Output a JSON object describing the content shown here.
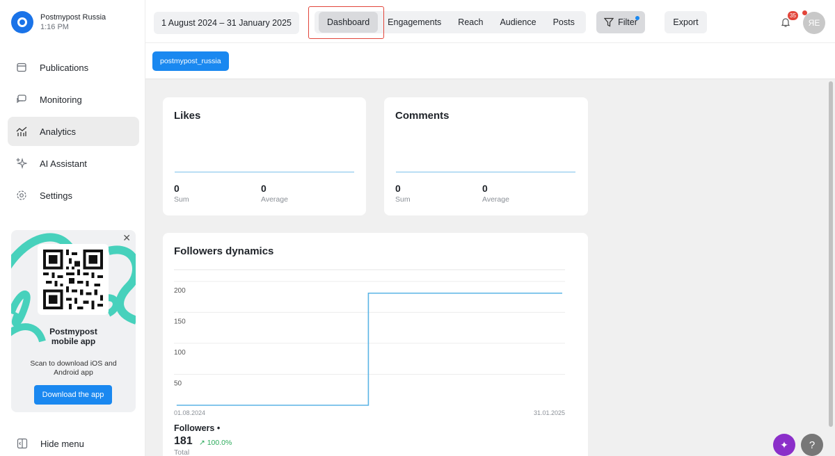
{
  "account": {
    "name": "Postmypost Russia",
    "time": "1:16 PM"
  },
  "nav": [
    {
      "label": "Publications",
      "icon": "calendar-icon"
    },
    {
      "label": "Monitoring",
      "icon": "chat-icon"
    },
    {
      "label": "Analytics",
      "icon": "analytics-icon",
      "active": true
    },
    {
      "label": "AI Assistant",
      "icon": "sparkle-icon"
    },
    {
      "label": "Settings",
      "icon": "gear-icon"
    }
  ],
  "promo": {
    "title": "Postmypost mobile app",
    "subtitle": "Scan to download iOS and Android app",
    "button": "Download the app",
    "close": "✕"
  },
  "hide_menu": "Hide menu",
  "topbar": {
    "date_range": "1 August 2024 – 31 January 2025",
    "tabs": [
      "Dashboard",
      "Engagements",
      "Reach",
      "Audience",
      "Posts"
    ],
    "active_tab": "Dashboard",
    "filter": "Filter",
    "export": "Export",
    "notifications": "35",
    "avatar": "ЯЕ"
  },
  "account_chip": "postmypost_russia",
  "cards": {
    "likes": {
      "title": "Likes",
      "sum": "0",
      "sum_label": "Sum",
      "avg": "0",
      "avg_label": "Average"
    },
    "comments": {
      "title": "Comments",
      "sum": "0",
      "sum_label": "Sum",
      "avg": "0",
      "avg_label": "Average"
    }
  },
  "followers": {
    "title": "Followers dynamics",
    "label": "Followers •",
    "value": "181",
    "change": "↗ 100.0%",
    "total_label": "Total"
  },
  "chart_data": {
    "type": "line",
    "title": "Followers dynamics",
    "x_start_label": "01.08.2024",
    "x_end_label": "31.01.2025",
    "yticks": [
      200,
      150,
      100,
      50
    ],
    "ylim": [
      0,
      220
    ],
    "series": [
      {
        "name": "Followers",
        "points": [
          {
            "x": "2024-08-01",
            "y": 0
          },
          {
            "x": "2024-10-31",
            "y": 0
          },
          {
            "x": "2024-10-31",
            "y": 181
          },
          {
            "x": "2025-01-31",
            "y": 181
          }
        ]
      }
    ],
    "color": "#5ab4e5",
    "grid": true
  },
  "colors": {
    "accent": "#1a88f0",
    "highlight": "#e2453a",
    "ai": "#8b2fc9"
  },
  "fab": {
    "ai": "✦",
    "help": "?"
  }
}
